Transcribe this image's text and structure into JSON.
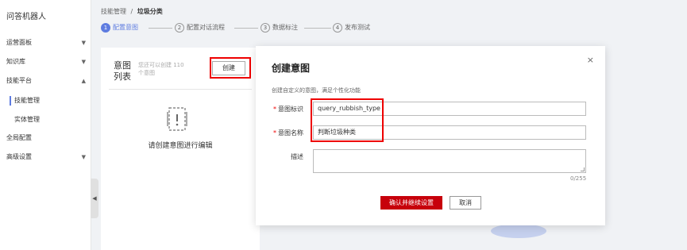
{
  "sidebar": {
    "title": "问答机器人",
    "items": [
      {
        "label": "运营面板",
        "arrow": "▼"
      },
      {
        "label": "知识库",
        "arrow": "▼"
      },
      {
        "label": "技能平台",
        "arrow": "▲"
      },
      {
        "label": "技能管理"
      },
      {
        "label": "实体管理"
      },
      {
        "label": "全局配置"
      },
      {
        "label": "高级设置",
        "arrow": "▼"
      }
    ],
    "collapse": "◀"
  },
  "breadcrumb": {
    "parent": "技能管理",
    "sep": "/",
    "current": "垃圾分类"
  },
  "steps": [
    {
      "num": "1",
      "label": "配置意图"
    },
    {
      "num": "2",
      "label": "配置对话流程"
    },
    {
      "num": "3",
      "label": "数据标注"
    },
    {
      "num": "4",
      "label": "发布测试"
    }
  ],
  "card": {
    "title": "意图列表",
    "hint": "您还可以创建 110 个意图",
    "create_label": "创建",
    "empty_text": "请创建意图进行编辑"
  },
  "modal": {
    "title": "创建意图",
    "close": "×",
    "subtitle": "创建自定义的意图，满足个性化功能",
    "fields": {
      "intent_id": {
        "label": "意图标识",
        "value": "query_rubbish_type"
      },
      "intent_name": {
        "label": "意图名称",
        "value": "判断垃圾种类"
      },
      "desc": {
        "label": "描述",
        "value": "",
        "count": "0/255"
      }
    },
    "required_mark": "*",
    "confirm_label": "确认并继续设置",
    "cancel_label": "取消"
  },
  "colors": {
    "accent": "#5e7ce0",
    "primary_button": "#c7000b",
    "highlight": "#e00000"
  }
}
